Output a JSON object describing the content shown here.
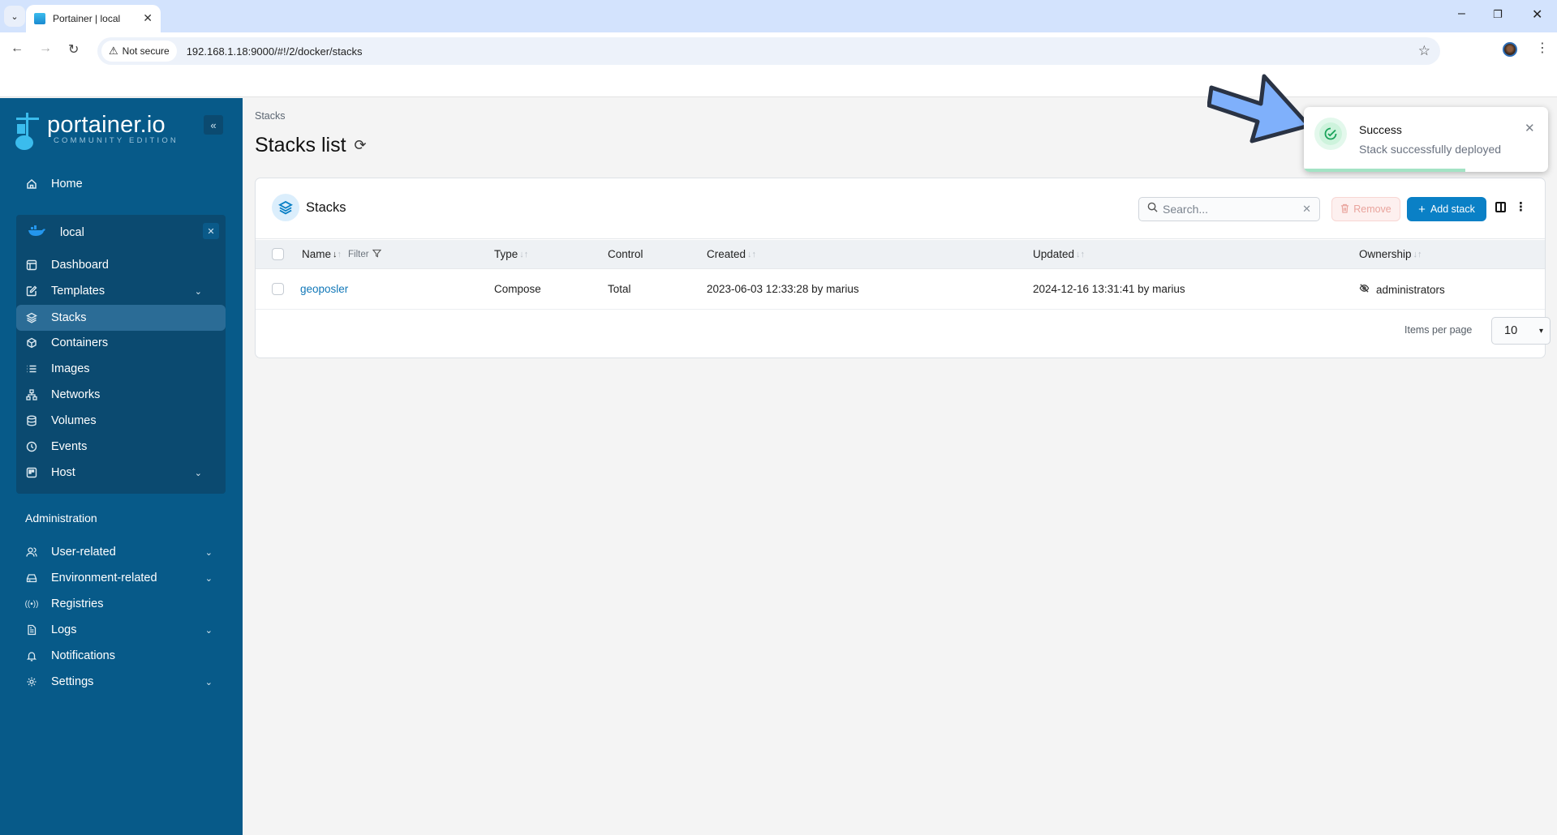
{
  "browser": {
    "tab_title": "Portainer | local",
    "security_label": "Not secure",
    "url": "192.168.1.18:9000/#!/2/docker/stacks"
  },
  "sidebar": {
    "logo_name": "portainer.io",
    "logo_edition": "COMMUNITY EDITION",
    "home_label": "Home",
    "environment": {
      "name": "local",
      "items": [
        {
          "label": "Dashboard",
          "icon": "dashboard-icon",
          "expandable": false,
          "active": false
        },
        {
          "label": "Templates",
          "icon": "edit-icon",
          "expandable": true,
          "active": false
        },
        {
          "label": "Stacks",
          "icon": "layers-icon",
          "expandable": false,
          "active": true
        },
        {
          "label": "Containers",
          "icon": "box-icon",
          "expandable": false,
          "active": false
        },
        {
          "label": "Images",
          "icon": "list-icon",
          "expandable": false,
          "active": false
        },
        {
          "label": "Networks",
          "icon": "network-icon",
          "expandable": false,
          "active": false
        },
        {
          "label": "Volumes",
          "icon": "database-icon",
          "expandable": false,
          "active": false
        },
        {
          "label": "Events",
          "icon": "clock-icon",
          "expandable": false,
          "active": false
        },
        {
          "label": "Host",
          "icon": "host-icon",
          "expandable": true,
          "active": false
        }
      ]
    },
    "admin_section_label": "Administration",
    "admin_items": [
      {
        "label": "User-related",
        "icon": "users-icon",
        "expandable": true
      },
      {
        "label": "Environment-related",
        "icon": "hard-drive-icon",
        "expandable": true
      },
      {
        "label": "Registries",
        "icon": "radio-icon",
        "expandable": false
      },
      {
        "label": "Logs",
        "icon": "file-text-icon",
        "expandable": true
      },
      {
        "label": "Notifications",
        "icon": "bell-icon",
        "expandable": false
      },
      {
        "label": "Settings",
        "icon": "gear-icon",
        "expandable": true
      }
    ]
  },
  "main": {
    "breadcrumb": "Stacks",
    "title": "Stacks list",
    "card": {
      "title": "Stacks",
      "search_placeholder": "Search...",
      "search_value": "",
      "remove_label": "Remove",
      "add_label": "Add stack",
      "columns": {
        "name": "Name",
        "filter": "Filter",
        "type": "Type",
        "control": "Control",
        "created": "Created",
        "updated": "Updated",
        "ownership": "Ownership"
      },
      "rows": [
        {
          "name": "geoposler",
          "type": "Compose",
          "control": "Total",
          "created": "2023-06-03 12:33:28 by marius",
          "updated": "2024-12-16 13:31:41 by marius",
          "ownership": "administrators"
        }
      ],
      "items_per_page_label": "Items per page",
      "items_per_page_value": "10"
    }
  },
  "toast": {
    "title": "Success",
    "message": "Stack successfully deployed",
    "progress": 0.66
  },
  "colors": {
    "sidebar_bg": "#075a89",
    "accent": "#0a80c6",
    "success": "#1aa35a",
    "annotation_arrow": "#7fb0fb"
  }
}
